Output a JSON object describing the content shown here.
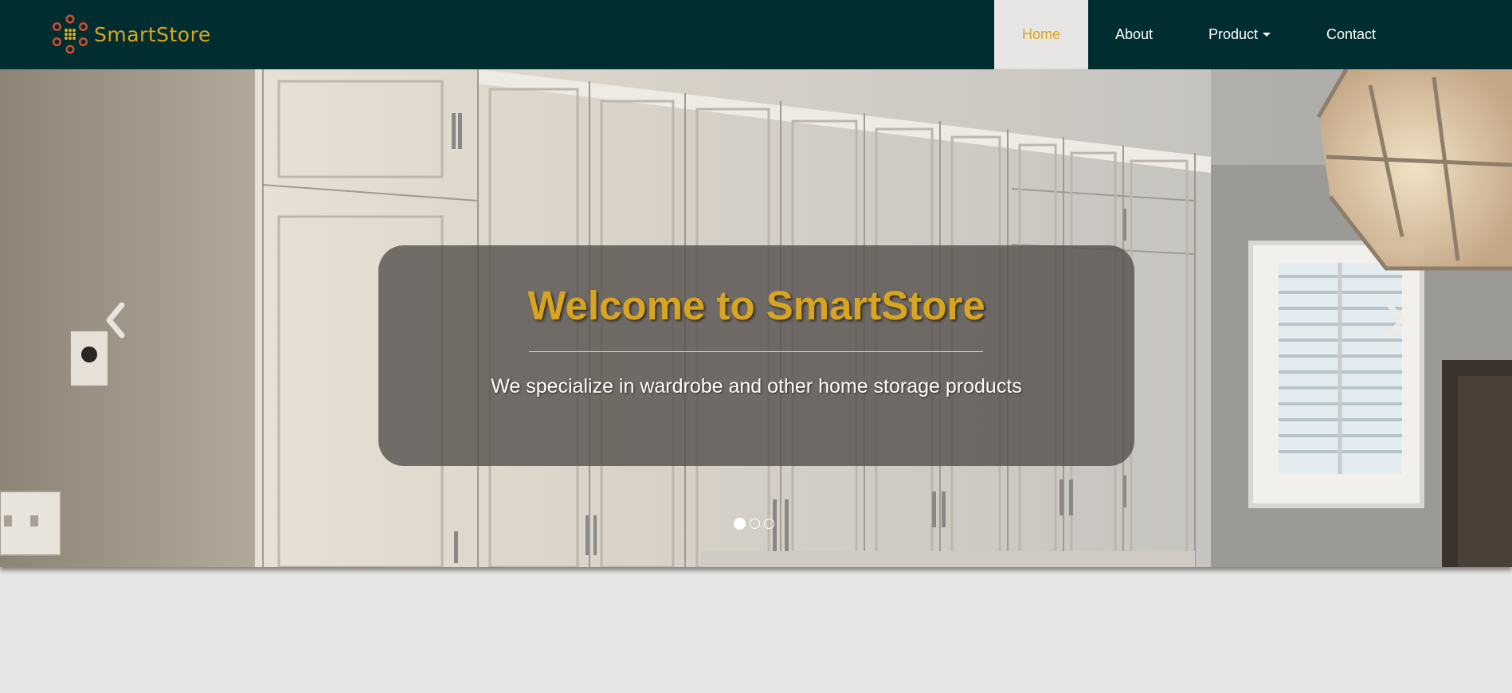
{
  "brand": {
    "name": "SmartStore",
    "logo_icon": "flower-dots-logo-icon"
  },
  "nav": {
    "items": [
      {
        "label": "Home",
        "active": true
      },
      {
        "label": "About",
        "active": false
      },
      {
        "label": "Product",
        "active": false,
        "has_dropdown": true
      },
      {
        "label": "Contact",
        "active": false
      }
    ]
  },
  "carousel": {
    "title": "Welcome to SmartStore",
    "subtitle": "We specialize in wardrobe and other home storage products",
    "prev_icon": "chevron-left-icon",
    "next_icon": "chevron-right-icon",
    "slide_count": 3,
    "active_slide": 1
  },
  "colors": {
    "navbar_bg": "#002e30",
    "accent": "#d9a521",
    "page_bg": "#e7e6e4",
    "caption_bg": "#55504c"
  }
}
